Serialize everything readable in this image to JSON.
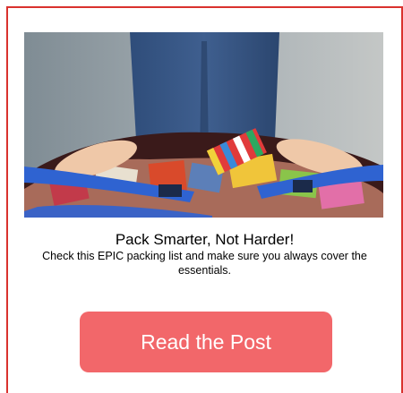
{
  "card": {
    "title": "Pack Smarter, Not Harder!",
    "description": "Check this EPIC packing list and make sure you always cover the essentials.",
    "button_label": "Read the Post"
  },
  "colors": {
    "border": "#d9322e",
    "button_bg": "#f2676a",
    "button_text": "#ffffff"
  }
}
